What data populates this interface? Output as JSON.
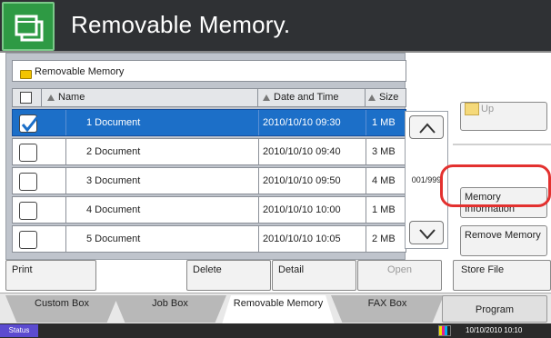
{
  "header": {
    "title": "Removable Memory."
  },
  "path": {
    "label": "Removable Memory"
  },
  "columns": {
    "name": "Name",
    "date": "Date and Time",
    "size": "Size"
  },
  "rows": [
    {
      "name": "1 Document",
      "date": "2010/10/10 09:30",
      "size": "1 MB",
      "selected": true
    },
    {
      "name": "2 Document",
      "date": "2010/10/10 09:40",
      "size": "3 MB",
      "selected": false
    },
    {
      "name": "3 Document",
      "date": "2010/10/10 09:50",
      "size": "4 MB",
      "selected": false
    },
    {
      "name": "4 Document",
      "date": "2010/10/10 10:00",
      "size": "1 MB",
      "selected": false
    },
    {
      "name": "5 Document",
      "date": "2010/10/10 10:05",
      "size": "2 MB",
      "selected": false
    }
  ],
  "pager": {
    "text": "001/999"
  },
  "side": {
    "up": "Up",
    "memory_info": "Memory Information",
    "remove_memory": "Remove Memory"
  },
  "actions": {
    "print": "Print",
    "delete": "Delete",
    "detail": "Detail",
    "open": "Open",
    "store": "Store File"
  },
  "tabs": {
    "custom": "Custom Box",
    "job": "Job Box",
    "removable": "Removable Memory",
    "fax": "FAX Box",
    "program": "Program"
  },
  "status": {
    "button": "Status",
    "clock": "10/10/2010  10:10"
  },
  "colors": {
    "header_bg": "#2f3134",
    "accent_green": "#2e9a44",
    "selection_blue": "#1c6fc8",
    "highlight_red": "#e3312f"
  }
}
